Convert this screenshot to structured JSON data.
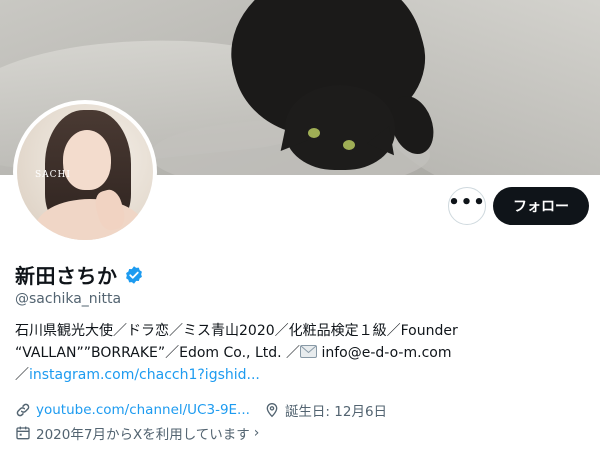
{
  "header": {
    "banner_subject": "black cat on couch"
  },
  "avatar": {
    "photo_text": "SACHI"
  },
  "actions": {
    "more_label": "•••",
    "follow_label": "フォロー"
  },
  "profile": {
    "display_name": "新田さちか",
    "verified": true,
    "handle": "@sachika_nitta",
    "bio_line1": "石川県観光大使／ドラ恋／ミス青山2020／化粧品検定１級／Founder",
    "bio_line2_prefix": "“VALLAN””BORRAKE”／Edom Co., Ltd. ／",
    "bio_line2_email": " info@e-d-o-m.com",
    "bio_line3_prefix": "／",
    "bio_link": "instagram.com/chacch1?igshid..."
  },
  "meta": {
    "website": "youtube.com/channel/UC3-9E...",
    "birthday": "誕生日: 12月6日",
    "joined": "2020年7月からXを利用しています"
  },
  "colors": {
    "accent": "#1d9bf0",
    "text": "#0f1419",
    "secondary": "#536471",
    "follow_bg": "#0f1419"
  },
  "icons": [
    "more-icon",
    "verified-badge-icon",
    "email-icon",
    "link-icon",
    "location-pin-icon",
    "calendar-icon",
    "chevron-right-icon"
  ]
}
